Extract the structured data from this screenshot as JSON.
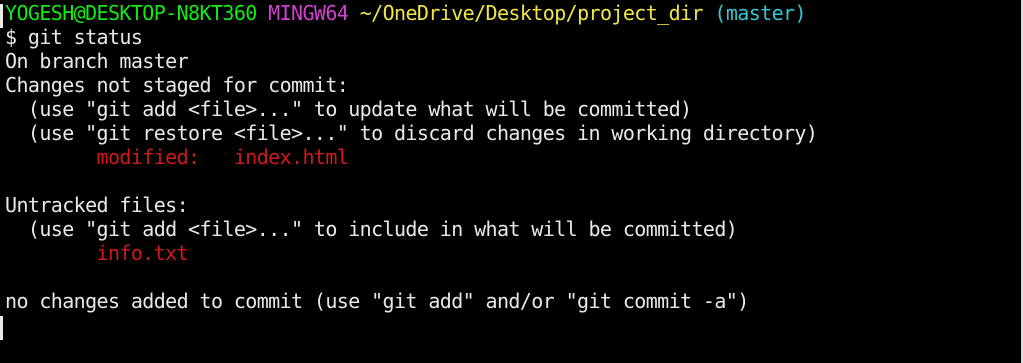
{
  "prompt": {
    "user_host": "YOGESH@DESKTOP-N8KT360",
    "system": "MINGW64",
    "path": "~/OneDrive/Desktop/project_dir",
    "branch": "(master)",
    "symbol": "$",
    "command": "git status"
  },
  "output": {
    "branch_line": "On branch master",
    "unstaged_header": "Changes not staged for commit:",
    "unstaged_hint_1": "  (use \"git add <file>...\" to update what will be committed)",
    "unstaged_hint_2": "  (use \"git restore <file>...\" to discard changes in working directory)",
    "unstaged_files": [
      {
        "indent": "        ",
        "status": "modified:",
        "gap": "   ",
        "file": "index.html"
      }
    ],
    "untracked_header": "Untracked files:",
    "untracked_hint": "  (use \"git add <file>...\" to include in what will be committed)",
    "untracked_files": [
      {
        "indent": "        ",
        "file": "info.txt"
      }
    ],
    "summary": "no changes added to commit (use \"git add\" and/or \"git commit -a\")"
  },
  "colors": {
    "background": "#000000",
    "text": "#e8e8e8",
    "user_host": "#13ec13",
    "system": "#d340d3",
    "path": "#f0e64a",
    "branch": "#35c7d0",
    "modified": "#d01919"
  }
}
